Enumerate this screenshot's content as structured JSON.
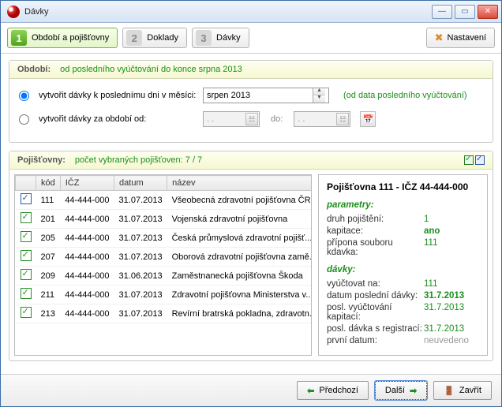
{
  "window": {
    "title": "Dávky"
  },
  "steps": [
    {
      "num": "1",
      "label": "Období a pojišťovny"
    },
    {
      "num": "2",
      "label": "Doklady"
    },
    {
      "num": "3",
      "label": "Dávky"
    }
  ],
  "settings_label": "Nastavení",
  "obdobi": {
    "header_label": "Období:",
    "header_value": "od posledního vyúčtování do konce srpna 2013",
    "radio1": "vytvořit dávky k poslednímu dni v měsíci:",
    "month": "srpen 2013",
    "note": "(od data posledního vyúčtování)",
    "radio2": "vytvořit dávky za období od:",
    "date_placeholder": " .  .",
    "do_label": "do:"
  },
  "pojistovny": {
    "header_label": "Pojišťovny:",
    "header_value": "počet vybraných pojišťoven: 7 / 7",
    "cols": {
      "kod": "kód",
      "icz": "IČZ",
      "datum": "datum",
      "nazev": "název"
    },
    "rows": [
      {
        "chk": "blue",
        "kod": "111",
        "icz": "44-444-000",
        "datum": "31.07.2013",
        "nazev": "Všeobecná zdravotní pojišťovna ČR"
      },
      {
        "chk": "green",
        "kod": "201",
        "icz": "44-444-000",
        "datum": "31.07.2013",
        "nazev": "Vojenská zdravotní pojišťovna"
      },
      {
        "chk": "green",
        "kod": "205",
        "icz": "44-444-000",
        "datum": "31.07.2013",
        "nazev": "Česká průmyslová zdravotní pojišť..."
      },
      {
        "chk": "green",
        "kod": "207",
        "icz": "44-444-000",
        "datum": "31.07.2013",
        "nazev": "Oborová zdravotní pojišťovna zamě..."
      },
      {
        "chk": "green",
        "kod": "209",
        "icz": "44-444-000",
        "datum": "31.06.2013",
        "nazev": "Zaměstnanecká pojišťovna Škoda"
      },
      {
        "chk": "green",
        "kod": "211",
        "icz": "44-444-000",
        "datum": "31.07.2013",
        "nazev": "Zdravotní pojišťovna Ministerstva v..."
      },
      {
        "chk": "green",
        "kod": "213",
        "icz": "44-444-000",
        "datum": "31.07.2013",
        "nazev": "Revírní bratrská pokladna, zdravotn..."
      }
    ]
  },
  "detail": {
    "title": "Pojišťovna 111 - IČZ 44-444-000",
    "params_header": "parametry:",
    "params": [
      {
        "k": "druh pojištění:",
        "v": "1",
        "cls": ""
      },
      {
        "k": "kapitace:",
        "v": "ano",
        "cls": "bold"
      },
      {
        "k": "přípona souboru kdavka:",
        "v": "111",
        "cls": ""
      }
    ],
    "davky_header": "dávky:",
    "davky": [
      {
        "k": "vyúčtovat na:",
        "v": "111",
        "cls": ""
      },
      {
        "k": "datum poslední dávky:",
        "v": "31.7.2013",
        "cls": "bold"
      },
      {
        "k": "posl. vyúčtování kapitací:",
        "v": "31.7.2013",
        "cls": ""
      },
      {
        "k": "posl. dávka s registrací:",
        "v": "31.7.2013",
        "cls": ""
      },
      {
        "k": "první datum:",
        "v": "neuvedeno",
        "cls": "grey"
      }
    ]
  },
  "footer": {
    "prev": "Předchozí",
    "next": "Další",
    "close": "Zavřít"
  }
}
